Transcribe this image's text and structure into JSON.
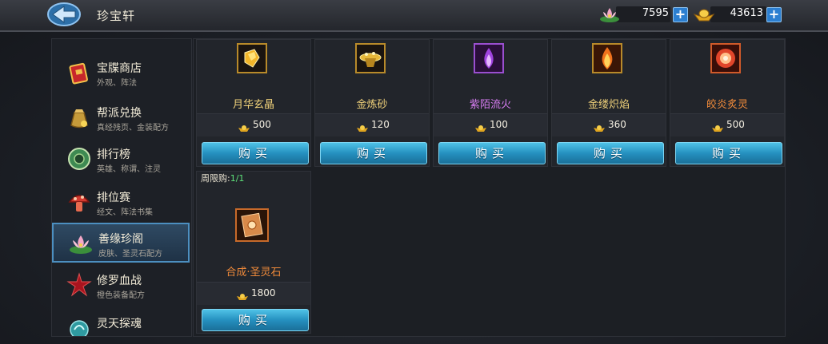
{
  "header": {
    "title": "珍宝轩",
    "currencies": [
      {
        "icon": "lotus-coin-icon",
        "value": "7595"
      },
      {
        "icon": "gold-ingot-icon",
        "value": "43613"
      }
    ]
  },
  "sidebar": {
    "items": [
      {
        "name": "宝牒商店",
        "sub": "外观、阵法",
        "icon": "red-scroll-icon"
      },
      {
        "name": "帮派兑换",
        "sub": "真经残页、金装配方",
        "icon": "money-bag-icon"
      },
      {
        "name": "排行榜",
        "sub": "英雄、称谓、注灵",
        "icon": "jade-disc-icon"
      },
      {
        "name": "排位赛",
        "sub": "经文、阵法书集",
        "icon": "red-mushroom-icon"
      },
      {
        "name": "善缘珍阁",
        "sub": "皮肤、圣灵石配方",
        "icon": "lotus-pavilion-icon"
      },
      {
        "name": "修罗血战",
        "sub": "橙色装备配方",
        "icon": "crimson-star-icon"
      },
      {
        "name": "灵天探魂",
        "sub": "",
        "icon": "spirit-orb-icon"
      }
    ]
  },
  "shop": {
    "buy_label": "购买",
    "items": [
      {
        "name": "月华玄晶",
        "price": "500",
        "name_color": "#f1d27a",
        "icon": "gold-crystal-icon"
      },
      {
        "name": "金炼砂",
        "price": "120",
        "name_color": "#f1d27a",
        "icon": "gold-sand-icon"
      },
      {
        "name": "紫陌流火",
        "price": "100",
        "name_color": "#d57cf0",
        "icon": "purple-flame-icon"
      },
      {
        "name": "金缕炽焰",
        "price": "360",
        "name_color": "#f1d27a",
        "icon": "orange-flame-icon"
      },
      {
        "name": "皎炎炙灵",
        "price": "500",
        "name_color": "#f08a3a",
        "icon": "red-flame-orb-icon"
      },
      {
        "name": "合成·圣灵石",
        "price": "1800",
        "name_color": "#f08a3a",
        "icon": "sacred-stone-scroll-icon",
        "limit_label": "周限购:",
        "limit_value": "1/1"
      }
    ]
  }
}
